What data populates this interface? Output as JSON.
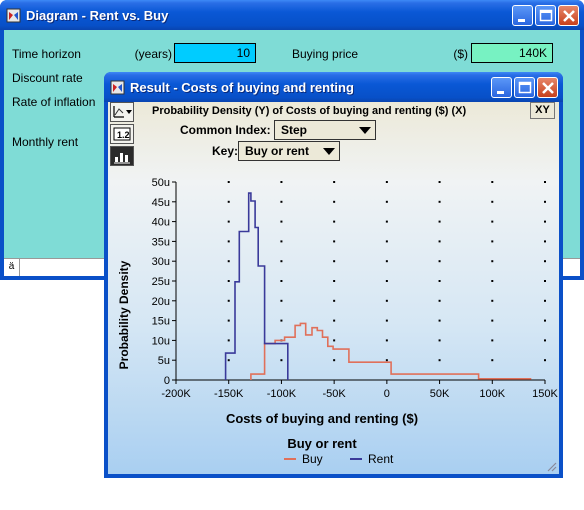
{
  "diagram_window": {
    "title": "Diagram - Rent vs. Buy",
    "fields": [
      {
        "label": "Time horizon",
        "unit": "(years)",
        "value": "10"
      },
      {
        "label": "Discount rate"
      },
      {
        "label": "Rate of inflation"
      },
      {
        "label": "Monthly rent"
      }
    ],
    "buying_price": {
      "label": "Buying price",
      "unit": "($)",
      "value": "140K"
    },
    "status_cell": "ä"
  },
  "result_window": {
    "title": "Result - Costs of buying and renting",
    "heading": "Probability Density (Y) of Costs of buying and renting ($) (X)",
    "xy_label": "XY",
    "common_index_label": "Common Index:",
    "common_index_value": "Step",
    "key_label": "Key:",
    "key_value": "Buy or rent"
  },
  "colors": {
    "title_bar": "#0a50c8",
    "diagram_bg": "#7fdcd6",
    "input_cyan": "#00ccff",
    "input_green": "#77f2c2",
    "buy_series": "#e0705a",
    "rent_series": "#3a3a9a"
  },
  "chart_data": {
    "type": "line",
    "step": true,
    "xlabel": "Costs of buying and renting ($)",
    "ylabel": "Probability Density",
    "xlim": [
      -200000,
      150000
    ],
    "ylim": [
      0,
      5e-05
    ],
    "x_ticks": [
      {
        "value": -200000,
        "label": "-200K"
      },
      {
        "value": -150000,
        "label": "-150K"
      },
      {
        "value": -100000,
        "label": "-100K"
      },
      {
        "value": -50000,
        "label": "-50K"
      },
      {
        "value": 0,
        "label": "0"
      },
      {
        "value": 50000,
        "label": "50K"
      },
      {
        "value": 100000,
        "label": "100K"
      },
      {
        "value": 150000,
        "label": "150K"
      }
    ],
    "y_ticks": [
      {
        "value": 0,
        "label": "0"
      },
      {
        "value": 5e-06,
        "label": "5u"
      },
      {
        "value": 1e-05,
        "label": "10u"
      },
      {
        "value": 1.5e-05,
        "label": "15u"
      },
      {
        "value": 2e-05,
        "label": "20u"
      },
      {
        "value": 2.5e-05,
        "label": "25u"
      },
      {
        "value": 3e-05,
        "label": "30u"
      },
      {
        "value": 3.5e-05,
        "label": "35u"
      },
      {
        "value": 4e-05,
        "label": "40u"
      },
      {
        "value": 4.5e-05,
        "label": "45u"
      },
      {
        "value": 5e-05,
        "label": "50u"
      }
    ],
    "grid": "dots",
    "legend": {
      "title": "Buy or rent",
      "position": "bottom-center"
    },
    "series": [
      {
        "name": "Buy",
        "color": "#e0705a",
        "x": [
          -129000,
          -129000,
          -116000,
          -116000,
          -106000,
          -106000,
          -97000,
          -97000,
          -87000,
          -87000,
          -82000,
          -82000,
          -77000,
          -77000,
          -71000,
          -71000,
          -66000,
          -66000,
          -61000,
          -61000,
          -56000,
          -56000,
          -51000,
          -51000,
          -36000,
          -36000,
          4000,
          4000,
          87000,
          87000,
          137000
        ],
        "y": [
          0,
          1.5e-06,
          1.5e-06,
          9.2e-06,
          9.2e-06,
          1e-05,
          1e-05,
          1.08e-05,
          1.08e-05,
          1.38e-05,
          1.38e-05,
          1.43e-05,
          1.43e-05,
          1.14e-05,
          1.14e-05,
          1.32e-05,
          1.32e-05,
          1.25e-05,
          1.25e-05,
          1.08e-05,
          1.08e-05,
          8.5e-06,
          8.5e-06,
          7.8e-06,
          7.8e-06,
          4.5e-06,
          4.5e-06,
          1.5e-06,
          1.5e-06,
          3e-07,
          3e-07
        ]
      },
      {
        "name": "Rent",
        "color": "#3a3a9a",
        "x": [
          -153000,
          -153000,
          -144000,
          -144000,
          -140000,
          -140000,
          -131000,
          -131000,
          -129000,
          -129000,
          -125000,
          -125000,
          -122000,
          -122000,
          -116000,
          -116000,
          -112000,
          -112000,
          -94000,
          -94000
        ],
        "y": [
          0,
          6.8e-06,
          6.8e-06,
          2.48e-05,
          2.48e-05,
          3.75e-05,
          3.75e-05,
          4.72e-05,
          4.72e-05,
          4.52e-05,
          4.52e-05,
          3.85e-05,
          3.85e-05,
          2.88e-05,
          2.88e-05,
          9.2e-06,
          9.2e-06,
          9.2e-06,
          9.2e-06,
          0
        ]
      }
    ]
  }
}
